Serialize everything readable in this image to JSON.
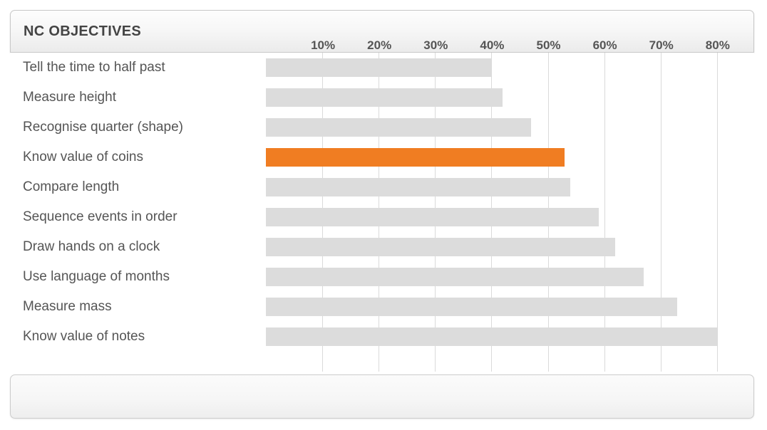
{
  "header": {
    "title": "NC OBJECTIVES"
  },
  "chart_data": {
    "type": "bar",
    "orientation": "horizontal",
    "title": "NC OBJECTIVES",
    "xlabel": "",
    "ylabel": "",
    "xlim": [
      0,
      88
    ],
    "grid": true,
    "legend": false,
    "tick_labels": [
      "10%",
      "20%",
      "30%",
      "40%",
      "50%",
      "60%",
      "70%",
      "80%"
    ],
    "tick_values": [
      10,
      20,
      30,
      40,
      50,
      60,
      70,
      80
    ],
    "bar_color": "#dcdcdc",
    "highlight_color": "#f07d22",
    "highlighted_category": "Know value of coins",
    "categories": [
      "Tell the time to half past",
      "Measure height",
      "Recognise quarter (shape)",
      "Know value of coins",
      "Compare length",
      "Sequence events in order",
      "Draw hands on a clock",
      "Use language of months",
      "Measure mass",
      "Know value of notes"
    ],
    "values": [
      40,
      42,
      47,
      53,
      54,
      59,
      62,
      67,
      73,
      80
    ],
    "points": [
      {
        "label": "Tell the time to half past",
        "value": 40,
        "highlight": false
      },
      {
        "label": "Measure height",
        "value": 42,
        "highlight": false
      },
      {
        "label": "Recognise quarter (shape)",
        "value": 47,
        "highlight": false
      },
      {
        "label": "Know value of coins",
        "value": 53,
        "highlight": true
      },
      {
        "label": "Compare length",
        "value": 54,
        "highlight": false
      },
      {
        "label": "Sequence events in order",
        "value": 59,
        "highlight": false
      },
      {
        "label": "Draw hands on a clock",
        "value": 62,
        "highlight": false
      },
      {
        "label": "Use language of months",
        "value": 67,
        "highlight": false
      },
      {
        "label": "Measure mass",
        "value": 73,
        "highlight": false
      },
      {
        "label": "Know value of notes",
        "value": 80,
        "highlight": false
      }
    ]
  }
}
